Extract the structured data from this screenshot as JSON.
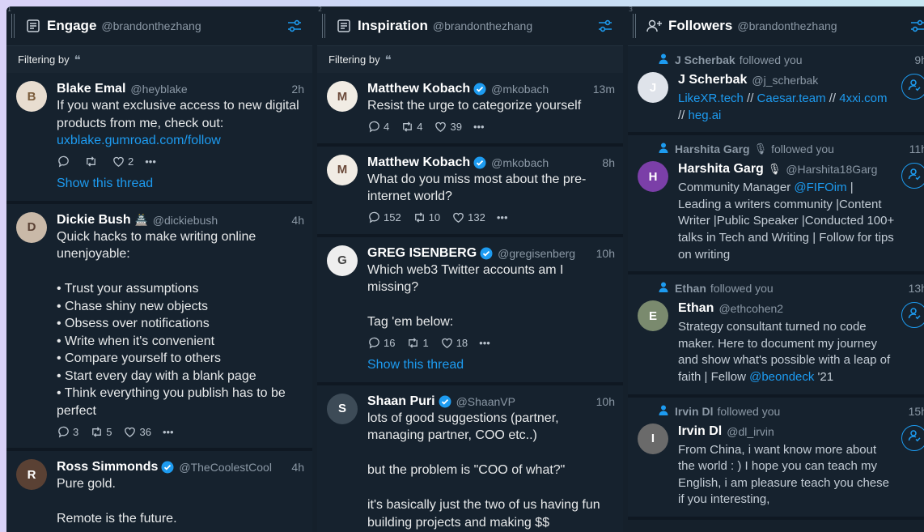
{
  "columns": [
    {
      "number": "1",
      "title": "Engage",
      "handle": "@brandonthezhang",
      "filter_label": "Filtering by",
      "tweets": [
        {
          "name": "Blake Emal",
          "handle": "@heyblake",
          "time": "2h",
          "text": "If you want exclusive access to new digital products from me, check out:",
          "link": "uxblake.gumroad.com/follow",
          "replies": "",
          "retweets": "",
          "likes": "2",
          "thread": "Show this thread",
          "avatar_bg": "#e8ddd0",
          "avatar_letter": "B"
        },
        {
          "name": "Dickie Bush",
          "emoji": "🏯",
          "handle": "@dickiebush",
          "time": "4h",
          "text": "Quick hacks to make writing online unenjoyable:\n\n• Trust your assumptions\n• Chase shiny new objects\n• Obsess over notifications\n• Write when it's convenient\n• Compare yourself to others\n• Start every day with a blank page\n• Think everything you publish has to be perfect",
          "replies": "3",
          "retweets": "5",
          "likes": "36",
          "avatar_bg": "#c9b9a8",
          "avatar_letter": "D"
        },
        {
          "name": "Ross Simmonds",
          "verified": true,
          "handle": "@TheCoolestCool",
          "time": "4h",
          "text": "Pure gold.\n\nRemote is the future.",
          "avatar_bg": "#5a4134",
          "avatar_letter": "R"
        }
      ]
    },
    {
      "number": "2",
      "title": "Inspiration",
      "handle": "@brandonthezhang",
      "filter_label": "Filtering by",
      "tweets": [
        {
          "name": "Matthew Kobach",
          "verified": true,
          "handle": "@mkobach",
          "time": "13m",
          "text": "Resist the urge to categorize yourself",
          "replies": "4",
          "retweets": "4",
          "likes": "39",
          "avatar_bg": "#f1ece4",
          "avatar_letter": "M"
        },
        {
          "name": "Matthew Kobach",
          "verified": true,
          "handle": "@mkobach",
          "time": "8h",
          "text": "What do you miss most about the pre-internet world?",
          "replies": "152",
          "retweets": "10",
          "likes": "132",
          "avatar_bg": "#f1ece4",
          "avatar_letter": "M"
        },
        {
          "name": "GREG ISENBERG",
          "verified": true,
          "handle": "@gregisenberg",
          "time": "10h",
          "text": "Which web3 Twitter accounts am I missing?\n\nTag 'em below:",
          "replies": "16",
          "retweets": "1",
          "likes": "18",
          "thread": "Show this thread",
          "avatar_bg": "#eeeeee",
          "avatar_letter": "G"
        },
        {
          "name": "Shaan Puri",
          "verified": true,
          "handle": "@ShaanVP",
          "time": "10h",
          "text": "lots of good suggestions (partner, managing partner, COO etc..)\n\nbut the problem is \"COO of what?\"\n\nit's basically just the two of us having fun building projects and making $$",
          "avatar_bg": "#3d4b57",
          "avatar_letter": "S"
        }
      ]
    },
    {
      "number": "3",
      "title": "Followers",
      "handle": "@brandonthezhang",
      "followers": [
        {
          "note_name": "J Scherbak",
          "note_text": "followed you",
          "time": "9h",
          "name": "J Scherbak",
          "handle": "@j_scherbak",
          "bio_parts": [
            {
              "t": "LikeXR.tech",
              "link": true
            },
            {
              "t": " // ",
              "link": false
            },
            {
              "t": "Caesar.team",
              "link": true
            },
            {
              "t": " // ",
              "link": false
            },
            {
              "t": "4xxi.com",
              "link": true
            },
            {
              "t": " // ",
              "link": false
            },
            {
              "t": "heg.ai",
              "link": true
            }
          ],
          "avatar_bg": "#dfe3ea",
          "avatar_letter": "J"
        },
        {
          "note_name": "Harshita Garg",
          "note_emoji": "🎙",
          "note_text": "followed you",
          "time": "11h",
          "name": "Harshita Garg",
          "name_emoji": "🎙",
          "handle": "@Harshita18Garg",
          "bio_parts": [
            {
              "t": "Community Manager ",
              "link": false
            },
            {
              "t": "@FIFOim",
              "link": true
            },
            {
              "t": " | Leading a writers community |Content Writer |Public Speaker |Conducted 100+ talks in Tech and Writing | Follow for tips on writing",
              "link": false
            }
          ],
          "avatar_bg": "#7b3fa8",
          "avatar_letter": "H"
        },
        {
          "note_name": "Ethan",
          "note_text": "followed you",
          "time": "13h",
          "name": "Ethan",
          "handle": "@ethcohen2",
          "bio_parts": [
            {
              "t": "Strategy consultant turned no code maker. Here to document my journey and show what's possible with a leap of faith | Fellow ",
              "link": false
            },
            {
              "t": "@beondeck",
              "link": true
            },
            {
              "t": " '21",
              "link": false
            }
          ],
          "avatar_bg": "#7a8a6e",
          "avatar_letter": "E"
        },
        {
          "note_name": "Irvin Dl",
          "note_text": "followed you",
          "time": "15h",
          "name": "Irvin Dl",
          "handle": "@dl_irvin",
          "bio_parts": [
            {
              "t": "From China, i want know more about the world : ) I hope you can teach my English, i am pleasure teach you chese if you interesting,",
              "link": false
            }
          ],
          "avatar_bg": "#6a6a6a",
          "avatar_letter": "I"
        }
      ]
    }
  ],
  "colors": {
    "accent": "#1d9bf0",
    "background": "#15202b",
    "muted": "#8b98a5"
  },
  "icons": {
    "engage_header": "list-icon",
    "inspiration_header": "list-icon",
    "followers_header": "add-person-icon",
    "settings": "sliders-icon",
    "reply": "reply-icon",
    "retweet": "retweet-icon",
    "like": "heart-icon",
    "more": "more-icon",
    "verified": "verified-icon",
    "follow": "follow-icon"
  }
}
